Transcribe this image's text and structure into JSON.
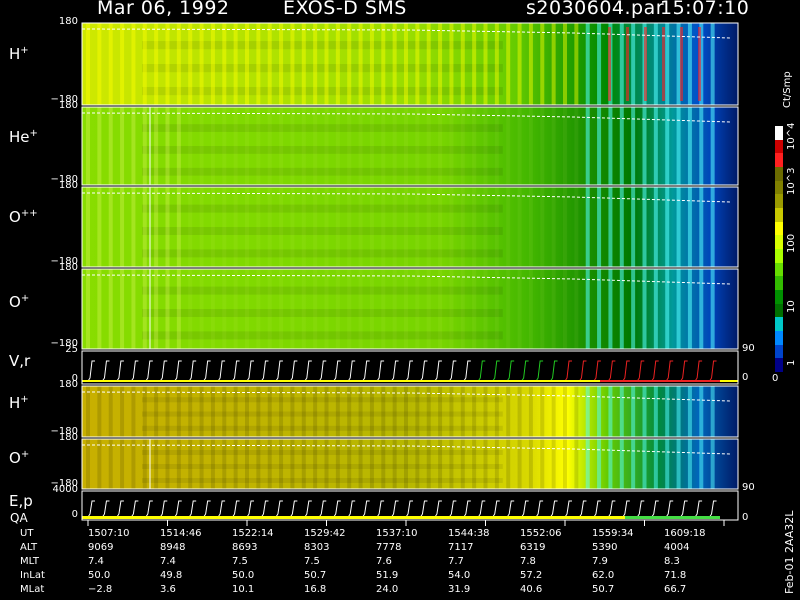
{
  "header": {
    "date": "Mar 06, 1992",
    "mission": "EXOS-D SMS",
    "file": "s2030604.par",
    "time": "15:07:10"
  },
  "panels": [
    {
      "label": "H",
      "sup": "+",
      "top_tick": "180",
      "bottom_tick": "−180"
    },
    {
      "label": "He",
      "sup": "+",
      "top_tick": "180",
      "bottom_tick": "−180"
    },
    {
      "label": "O",
      "sup": "++",
      "top_tick": "180",
      "bottom_tick": "−180"
    },
    {
      "label": "O",
      "sup": "+",
      "top_tick": "180",
      "bottom_tick": "−180"
    },
    {
      "label": "V,r",
      "sup": "",
      "top_tick": "25",
      "bottom_tick": "0"
    },
    {
      "label": "H",
      "sup": "+",
      "top_tick": "180",
      "bottom_tick": "−180"
    },
    {
      "label": "O",
      "sup": "+",
      "top_tick": "180",
      "bottom_tick": "−180"
    },
    {
      "label": "E,p",
      "sup": "",
      "top_tick": "4000",
      "bottom_tick": "0"
    }
  ],
  "qa_label": "QA",
  "right_ticks": {
    "vr_top": "90",
    "vr_bottom": "0",
    "ep_top": "90",
    "ep_bottom": "0"
  },
  "colorbar": {
    "unit": "Ct/Smp",
    "labels": [
      "10^4",
      "10^3",
      "100",
      "10",
      "1",
      "0"
    ],
    "colors": [
      "#ffffff",
      "#cc0000",
      "#ff2020",
      "#6b6b00",
      "#808000",
      "#9a9a00",
      "#c8c800",
      "#ffff00",
      "#d8ff00",
      "#aaff00",
      "#66dd00",
      "#33bb00",
      "#009000",
      "#007000",
      "#00c8c8",
      "#0088ff",
      "#0044cc",
      "#000088"
    ]
  },
  "footer_id": "Feb-01 2AA32L",
  "table": {
    "rows": [
      {
        "name": "UT",
        "values": [
          "1507:10",
          "1514:46",
          "1522:14",
          "1529:42",
          "1537:10",
          "1544:38",
          "1552:06",
          "1559:34",
          "1609:18"
        ]
      },
      {
        "name": "ALT",
        "values": [
          "9069",
          "8948",
          "8693",
          "8303",
          "7778",
          "7117",
          "6319",
          "5390",
          "4004"
        ]
      },
      {
        "name": "MLT",
        "values": [
          "7.4",
          "7.4",
          "7.5",
          "7.5",
          "7.6",
          "7.7",
          "7.8",
          "7.9",
          "8.3"
        ]
      },
      {
        "name": "InLat",
        "values": [
          "50.0",
          "49.8",
          "50.0",
          "50.7",
          "51.9",
          "54.0",
          "57.2",
          "62.0",
          "71.8"
        ]
      },
      {
        "name": "MLat",
        "values": [
          "−2.8",
          "3.6",
          "10.1",
          "16.8",
          "24.0",
          "31.9",
          "40.6",
          "50.7",
          "66.7"
        ]
      }
    ]
  },
  "chart_data": {
    "type": "heatmap",
    "title": "Mar 06, 1992   EXOS-D SMS",
    "x": [
      "1507:10",
      "1514:46",
      "1522:14",
      "1529:42",
      "1537:10",
      "1544:38",
      "1552:06",
      "1559:34",
      "1609:18"
    ],
    "series": [
      {
        "name": "H+",
        "ylim": [
          -180,
          180
        ]
      },
      {
        "name": "He+",
        "ylim": [
          -180,
          180
        ]
      },
      {
        "name": "O++",
        "ylim": [
          -180,
          180
        ]
      },
      {
        "name": "O+",
        "ylim": [
          -180,
          180
        ]
      },
      {
        "name": "V,r",
        "ylim": [
          0,
          25
        ]
      },
      {
        "name": "H+",
        "ylim": [
          -180,
          180
        ]
      },
      {
        "name": "O+",
        "ylim": [
          -180,
          180
        ]
      },
      {
        "name": "E,p",
        "ylim": [
          0,
          4000
        ]
      }
    ],
    "color_scale": "log",
    "color_unit": "Ct/Smp"
  }
}
